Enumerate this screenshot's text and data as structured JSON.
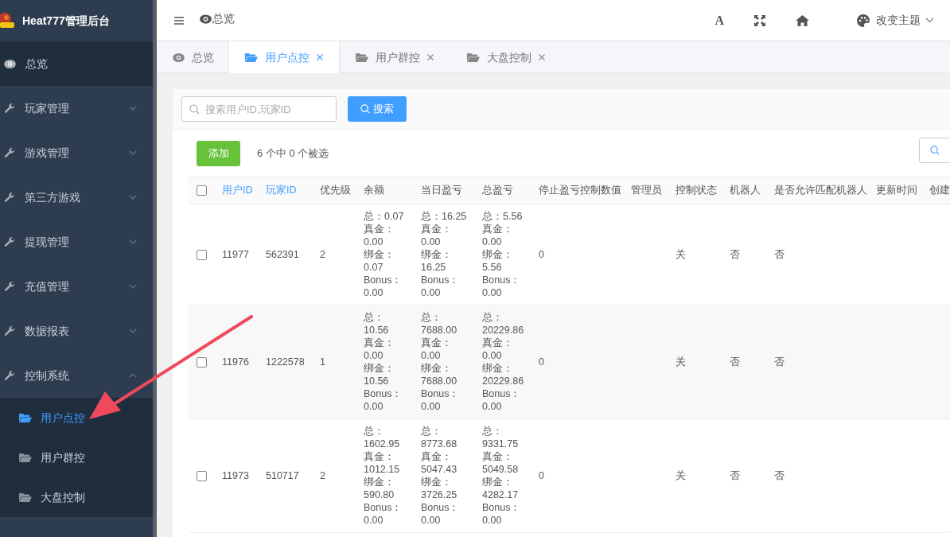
{
  "app_title": "Heat777管理后台",
  "sidebar": {
    "items": [
      {
        "label": "总览",
        "kind": "link",
        "selected": true
      },
      {
        "label": "玩家管理",
        "kind": "submenu",
        "expanded": false,
        "selected": false
      },
      {
        "label": "游戏管理",
        "kind": "submenu",
        "expanded": false,
        "selected": false
      },
      {
        "label": "第三方游戏",
        "kind": "submenu",
        "expanded": false,
        "selected": false
      },
      {
        "label": "提现管理",
        "kind": "submenu",
        "expanded": false,
        "selected": false
      },
      {
        "label": "充值管理",
        "kind": "submenu",
        "expanded": false,
        "selected": false
      },
      {
        "label": "数据报表",
        "kind": "submenu",
        "expanded": false,
        "selected": false
      },
      {
        "label": "控制系统",
        "kind": "submenu",
        "expanded": true,
        "selected": false,
        "children": [
          {
            "label": "用户点控",
            "selected": true
          },
          {
            "label": "用户群控",
            "selected": false
          },
          {
            "label": "大盘控制",
            "selected": false
          }
        ]
      }
    ]
  },
  "header": {
    "breadcrumb": "总览",
    "font_icon": "A",
    "theme_label": "改变主题"
  },
  "tabs": [
    {
      "label": "总览",
      "kind": "home",
      "closable": false,
      "selected": false
    },
    {
      "label": "用户点控",
      "kind": "page",
      "closable": true,
      "selected": true
    },
    {
      "label": "用户群控",
      "kind": "page",
      "closable": true,
      "selected": false
    },
    {
      "label": "大盘控制",
      "kind": "page",
      "closable": true,
      "selected": false
    }
  ],
  "search": {
    "placeholder": "搜索用户ID,玩家ID",
    "button": "搜索"
  },
  "toolbar": {
    "add_button": "添加",
    "selection_info": "6 个中 0 个被选"
  },
  "table": {
    "all_checked": false,
    "columns": [
      {
        "label": "用户ID",
        "sortable": true
      },
      {
        "label": "玩家ID",
        "sortable": true
      },
      {
        "label": "优先级",
        "sortable": false
      },
      {
        "label": "余额",
        "sortable": false
      },
      {
        "label": "当日盈亏",
        "sortable": false
      },
      {
        "label": "总盈亏",
        "sortable": false
      },
      {
        "label": "停止盈亏控制数值",
        "sortable": false
      },
      {
        "label": "管理员",
        "sortable": false
      },
      {
        "label": "控制状态",
        "sortable": false
      },
      {
        "label": "机器人",
        "sortable": false
      },
      {
        "label": "是否允许匹配机器人",
        "sortable": false
      },
      {
        "label": "更新时间",
        "sortable": false
      },
      {
        "label": "创建",
        "sortable": false
      }
    ],
    "rows": [
      {
        "checked": false,
        "user_id": "11977",
        "player_id": "562391",
        "priority": "2",
        "balance": [
          "总：0.07",
          "真金：",
          "0.00",
          "绑金：",
          "0.07",
          "Bonus：",
          "0.00"
        ],
        "daily_pnl": [
          "总：16.25",
          "真金：",
          "0.00",
          "绑金：",
          "16.25",
          "Bonus：",
          "0.00"
        ],
        "total_pnl": [
          "总：5.56",
          "真金：",
          "0.00",
          "绑金：",
          "5.56",
          "Bonus：",
          "0.00"
        ],
        "stop_value": "0",
        "control_state": "关",
        "robot": "否",
        "allow_robot": "否"
      },
      {
        "checked": false,
        "user_id": "11976",
        "player_id": "1222578",
        "priority": "1",
        "balance": [
          "总：",
          "10.56",
          "真金：",
          "0.00",
          "绑金：",
          "10.56",
          "Bonus：",
          "0.00"
        ],
        "daily_pnl": [
          "总：",
          "7688.00",
          "真金：",
          "0.00",
          "绑金：",
          "7688.00",
          "Bonus：",
          "0.00"
        ],
        "total_pnl": [
          "总：",
          "20229.86",
          "真金：",
          "0.00",
          "绑金：",
          "20229.86",
          "Bonus：",
          "0.00"
        ],
        "stop_value": "0",
        "control_state": "关",
        "robot": "否",
        "allow_robot": "否"
      },
      {
        "checked": false,
        "user_id": "11973",
        "player_id": "510717",
        "priority": "2",
        "balance": [
          "总：",
          "1602.95",
          "真金：",
          "1012.15",
          "绑金：",
          "590.80",
          "Bonus：",
          "0.00"
        ],
        "daily_pnl": [
          "总：",
          "8773.68",
          "真金：",
          "5047.43",
          "绑金：",
          "3726.25",
          "Bonus：",
          "0.00"
        ],
        "total_pnl": [
          "总：",
          "9331.75",
          "真金：",
          "5049.58",
          "绑金：",
          "4282.17",
          "Bonus：",
          "0.00"
        ],
        "stop_value": "0",
        "control_state": "关",
        "robot": "否",
        "allow_robot": "否"
      }
    ]
  }
}
